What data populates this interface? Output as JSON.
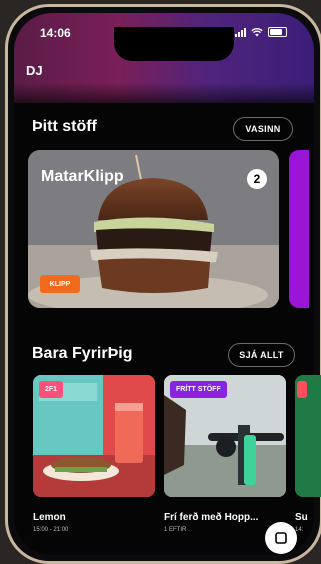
{
  "status_bar": {
    "time": "14:06"
  },
  "header": {
    "title": "DJ"
  },
  "section_featured": {
    "title": "Þitt stöff",
    "action": "VASINN",
    "card": {
      "title": "MatarKlipp",
      "count": "2",
      "badge": "KLIPP"
    }
  },
  "section_for_you": {
    "title": "Bara FyrirÞig",
    "action": "SJÁ ALLT",
    "cards": [
      {
        "badge": "2F1",
        "title": "Lemon",
        "subtitle": "15:00 - 21:00",
        "badge_color": "#ff4f7a"
      },
      {
        "badge": "FRÍTT STÖFF",
        "title": "Frí ferð með Hopp...",
        "subtitle": "1 EFTIR",
        "badge_color": "#8a23e0"
      },
      {
        "title": "Su",
        "subtitle": "14:"
      }
    ]
  },
  "icons": {
    "signal": "signal-icon",
    "wifi": "wifi-icon",
    "battery": "battery-icon",
    "fab": "scan-icon"
  }
}
